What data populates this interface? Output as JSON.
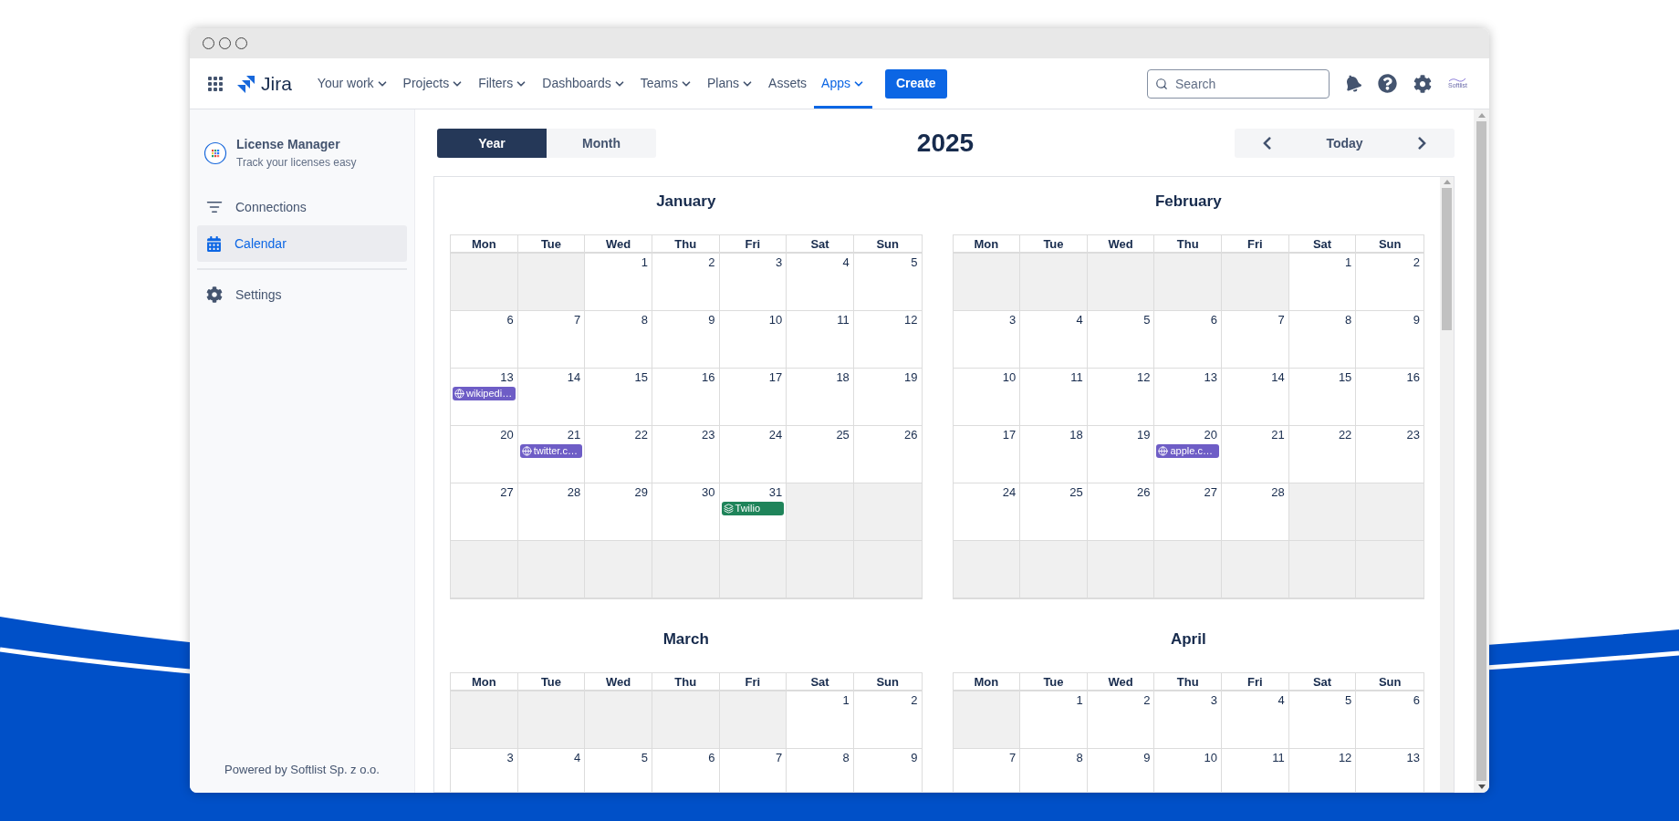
{
  "nav": {
    "logo_text": "Jira",
    "items": [
      {
        "label": "Your work",
        "dropdown": true,
        "selected": false
      },
      {
        "label": "Projects",
        "dropdown": true,
        "selected": false
      },
      {
        "label": "Filters",
        "dropdown": true,
        "selected": false
      },
      {
        "label": "Dashboards",
        "dropdown": true,
        "selected": false
      },
      {
        "label": "Teams",
        "dropdown": true,
        "selected": false
      },
      {
        "label": "Plans",
        "dropdown": true,
        "selected": false
      },
      {
        "label": "Assets",
        "dropdown": false,
        "selected": false
      },
      {
        "label": "Apps",
        "dropdown": true,
        "selected": true
      }
    ],
    "create_button": "Create",
    "search": {
      "placeholder": "Search"
    },
    "brand_logo_text": "Softlist"
  },
  "sidebar": {
    "app_title": "License Manager",
    "app_subtitle": "Track your licenses easy",
    "items": [
      {
        "label": "Connections",
        "kind": "filter",
        "selected": false
      },
      {
        "label": "Calendar",
        "kind": "calendar",
        "selected": true
      }
    ],
    "bottom_items": [
      {
        "label": "Settings",
        "kind": "settings",
        "selected": false
      }
    ],
    "footer": "Powered by Softlist Sp. z o.o."
  },
  "toolbar": {
    "views": [
      {
        "label": "Year",
        "selected": true
      },
      {
        "label": "Month",
        "selected": false
      }
    ],
    "year": "2025",
    "today_button": "Today"
  },
  "months": [
    {
      "name": "January",
      "weekdays": [
        "Mon",
        "Tue",
        "Wed",
        "Thu",
        "Fri",
        "Sat",
        "Sun"
      ],
      "weeks": [
        [
          {
            "outside": true
          },
          {
            "outside": true
          },
          {
            "outside": false,
            "day": "1"
          },
          {
            "outside": false,
            "day": "2"
          },
          {
            "outside": false,
            "day": "3"
          },
          {
            "outside": false,
            "day": "4"
          },
          {
            "outside": false,
            "day": "5"
          }
        ],
        [
          {
            "outside": false,
            "day": "6"
          },
          {
            "outside": false,
            "day": "7"
          },
          {
            "outside": false,
            "day": "8"
          },
          {
            "outside": false,
            "day": "9"
          },
          {
            "outside": false,
            "day": "10"
          },
          {
            "outside": false,
            "day": "11"
          },
          {
            "outside": false,
            "day": "12"
          }
        ],
        [
          {
            "outside": false,
            "day": "13",
            "events": [
              {
                "label": "wikipedi…",
                "kind": "website",
                "color": "#6e5dc6"
              }
            ]
          },
          {
            "outside": false,
            "day": "14"
          },
          {
            "outside": false,
            "day": "15"
          },
          {
            "outside": false,
            "day": "16"
          },
          {
            "outside": false,
            "day": "17"
          },
          {
            "outside": false,
            "day": "18"
          },
          {
            "outside": false,
            "day": "19"
          }
        ],
        [
          {
            "outside": false,
            "day": "20"
          },
          {
            "outside": false,
            "day": "21",
            "events": [
              {
                "label": "twitter.c…",
                "kind": "website",
                "color": "#6e5dc6"
              }
            ]
          },
          {
            "outside": false,
            "day": "22"
          },
          {
            "outside": false,
            "day": "23"
          },
          {
            "outside": false,
            "day": "24"
          },
          {
            "outside": false,
            "day": "25"
          },
          {
            "outside": false,
            "day": "26"
          }
        ],
        [
          {
            "outside": false,
            "day": "27"
          },
          {
            "outside": false,
            "day": "28"
          },
          {
            "outside": false,
            "day": "29"
          },
          {
            "outside": false,
            "day": "30"
          },
          {
            "outside": false,
            "day": "31",
            "events": [
              {
                "label": "Twilio",
                "kind": "product",
                "color": "#1f845a"
              }
            ]
          },
          {
            "outside": true
          },
          {
            "outside": true
          }
        ],
        [
          {
            "outside": true
          },
          {
            "outside": true
          },
          {
            "outside": true
          },
          {
            "outside": true
          },
          {
            "outside": true
          },
          {
            "outside": true
          },
          {
            "outside": true
          }
        ]
      ]
    },
    {
      "name": "February",
      "weekdays": [
        "Mon",
        "Tue",
        "Wed",
        "Thu",
        "Fri",
        "Sat",
        "Sun"
      ],
      "weeks": [
        [
          {
            "outside": true
          },
          {
            "outside": true
          },
          {
            "outside": true
          },
          {
            "outside": true
          },
          {
            "outside": true
          },
          {
            "outside": false,
            "day": "1"
          },
          {
            "outside": false,
            "day": "2"
          }
        ],
        [
          {
            "outside": false,
            "day": "3"
          },
          {
            "outside": false,
            "day": "4"
          },
          {
            "outside": false,
            "day": "5"
          },
          {
            "outside": false,
            "day": "6"
          },
          {
            "outside": false,
            "day": "7"
          },
          {
            "outside": false,
            "day": "8"
          },
          {
            "outside": false,
            "day": "9"
          }
        ],
        [
          {
            "outside": false,
            "day": "10"
          },
          {
            "outside": false,
            "day": "11"
          },
          {
            "outside": false,
            "day": "12"
          },
          {
            "outside": false,
            "day": "13"
          },
          {
            "outside": false,
            "day": "14"
          },
          {
            "outside": false,
            "day": "15"
          },
          {
            "outside": false,
            "day": "16"
          }
        ],
        [
          {
            "outside": false,
            "day": "17"
          },
          {
            "outside": false,
            "day": "18"
          },
          {
            "outside": false,
            "day": "19"
          },
          {
            "outside": false,
            "day": "20",
            "events": [
              {
                "label": "apple.c…",
                "kind": "website",
                "color": "#6e5dc6"
              }
            ]
          },
          {
            "outside": false,
            "day": "21"
          },
          {
            "outside": false,
            "day": "22"
          },
          {
            "outside": false,
            "day": "23"
          }
        ],
        [
          {
            "outside": false,
            "day": "24"
          },
          {
            "outside": false,
            "day": "25"
          },
          {
            "outside": false,
            "day": "26"
          },
          {
            "outside": false,
            "day": "27"
          },
          {
            "outside": false,
            "day": "28"
          },
          {
            "outside": true
          },
          {
            "outside": true
          }
        ],
        [
          {
            "outside": true
          },
          {
            "outside": true
          },
          {
            "outside": true
          },
          {
            "outside": true
          },
          {
            "outside": true
          },
          {
            "outside": true
          },
          {
            "outside": true
          }
        ]
      ]
    },
    {
      "name": "March",
      "weekdays": [
        "Mon",
        "Tue",
        "Wed",
        "Thu",
        "Fri",
        "Sat",
        "Sun"
      ],
      "weeks": [
        [
          {
            "outside": true
          },
          {
            "outside": true
          },
          {
            "outside": true
          },
          {
            "outside": true
          },
          {
            "outside": true
          },
          {
            "outside": false,
            "day": "1"
          },
          {
            "outside": false,
            "day": "2"
          }
        ],
        [
          {
            "outside": false,
            "day": "3"
          },
          {
            "outside": false,
            "day": "4"
          },
          {
            "outside": false,
            "day": "5"
          },
          {
            "outside": false,
            "day": "6"
          },
          {
            "outside": false,
            "day": "7"
          },
          {
            "outside": false,
            "day": "8"
          },
          {
            "outside": false,
            "day": "9"
          }
        ]
      ]
    },
    {
      "name": "April",
      "weekdays": [
        "Mon",
        "Tue",
        "Wed",
        "Thu",
        "Fri",
        "Sat",
        "Sun"
      ],
      "weeks": [
        [
          {
            "outside": true
          },
          {
            "outside": false,
            "day": "1"
          },
          {
            "outside": false,
            "day": "2"
          },
          {
            "outside": false,
            "day": "3"
          },
          {
            "outside": false,
            "day": "4"
          },
          {
            "outside": false,
            "day": "5"
          },
          {
            "outside": false,
            "day": "6"
          }
        ],
        [
          {
            "outside": false,
            "day": "7"
          },
          {
            "outside": false,
            "day": "8"
          },
          {
            "outside": false,
            "day": "9"
          },
          {
            "outside": false,
            "day": "10"
          },
          {
            "outside": false,
            "day": "11"
          },
          {
            "outside": false,
            "day": "12"
          },
          {
            "outside": false,
            "day": "13"
          }
        ]
      ]
    }
  ]
}
